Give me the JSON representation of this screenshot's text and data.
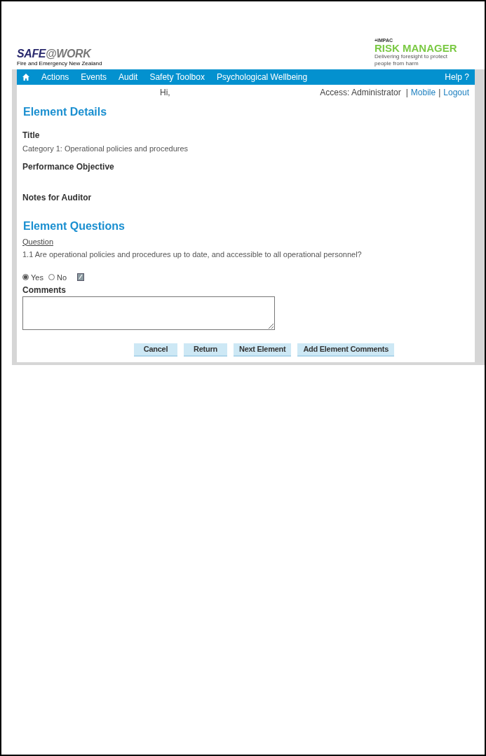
{
  "header": {
    "brand": {
      "name_a": "SAFE",
      "name_b": "@WORK",
      "subtitle": "Fire and Emergency New Zealand"
    },
    "partner_logo": {
      "small": "+IMPAC",
      "name": "RISK MANAGER",
      "tagline": "Delivering foresight to protect people from harm"
    }
  },
  "nav": {
    "items": [
      "Actions",
      "Events",
      "Audit",
      "Safety Toolbox",
      "Psychological Wellbeing"
    ],
    "help": "Help ?"
  },
  "user_bar": {
    "greeting": "Hi,",
    "access": "Access: Administrator",
    "separator_1": "|",
    "mobile": "Mobile",
    "separator_2": "|",
    "logout": "Logout"
  },
  "element_details": {
    "heading": "Element Details",
    "fields": [
      {
        "label": "Title",
        "value": "Category 1: Operational policies and procedures"
      },
      {
        "label": "Performance Objective"
      },
      {
        "label": "Notes for Auditor"
      }
    ]
  },
  "element_questions": {
    "heading": "Element Questions",
    "question_label": "Question",
    "question": "1.1 Are operational policies and procedures up to date, and accessible to all operational personnel?",
    "answers": [
      {
        "label": "Yes",
        "selected": true
      },
      {
        "label": "No",
        "selected": false
      }
    ],
    "comments_label": "Comments"
  },
  "buttons": [
    "Cancel",
    "Return",
    "Next Element",
    "Add Element Comments"
  ]
}
